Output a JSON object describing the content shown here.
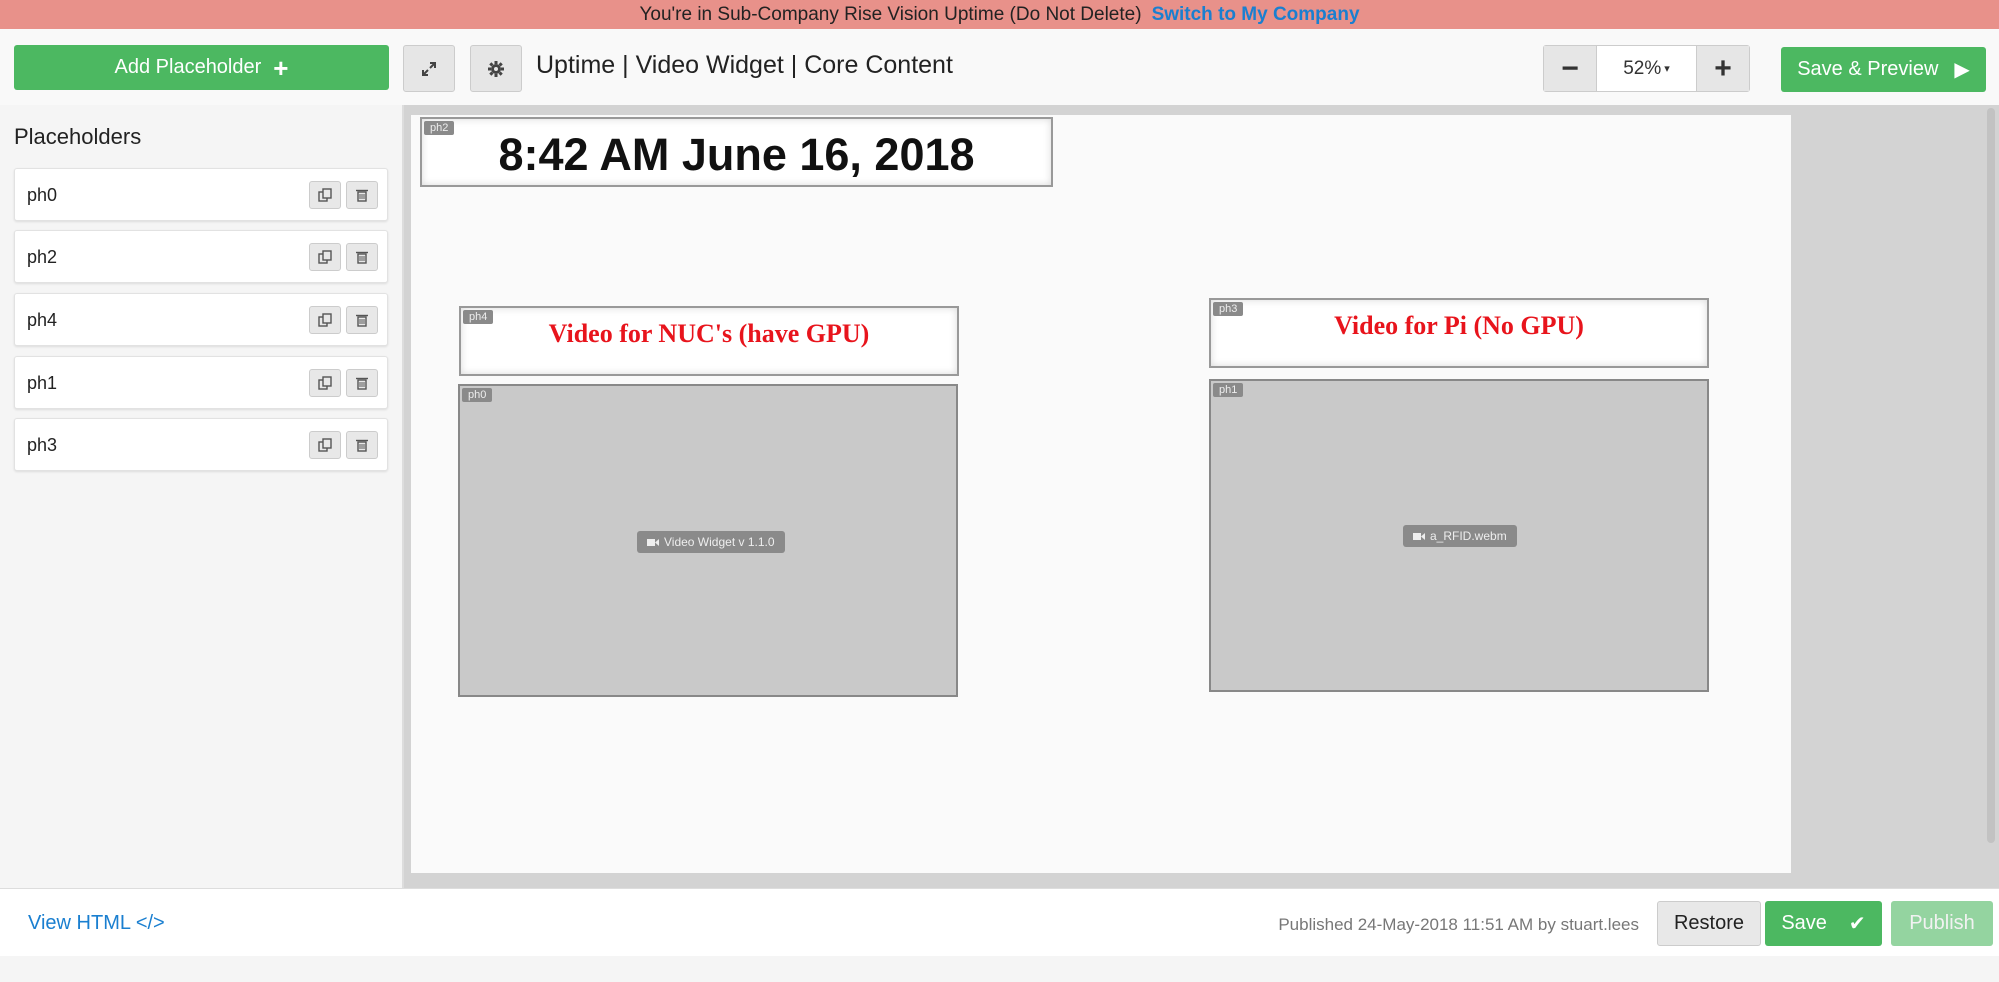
{
  "banner": {
    "message": "You're in Sub-Company Rise Vision Uptime (Do Not Delete)",
    "link": "Switch to My Company"
  },
  "toolbar": {
    "add_placeholder_label": "Add Placeholder",
    "add_placeholder_icon": "+",
    "expand_icon": "expand-icon",
    "settings_icon": "gear-icon",
    "presentation_title": "Uptime | Video Widget | Core Content",
    "zoom_out": "−",
    "zoom_value": "52%",
    "zoom_caret": "▾",
    "zoom_in": "+",
    "save_preview_label": "Save & Preview",
    "save_preview_icon": "▶"
  },
  "sidebar": {
    "title": "Placeholders",
    "items": [
      {
        "label": "ph0"
      },
      {
        "label": "ph2"
      },
      {
        "label": "ph4"
      },
      {
        "label": "ph1"
      },
      {
        "label": "ph3"
      }
    ]
  },
  "canvas": {
    "ph2": {
      "tag": "ph2",
      "content": "8:42 AM June 16, 2018"
    },
    "ph4": {
      "tag": "ph4",
      "content": "Video for NUC's (have GPU)"
    },
    "ph3": {
      "tag": "ph3",
      "content": "Video for Pi (No GPU)"
    },
    "ph0": {
      "tag": "ph0",
      "widget": "Video Widget v 1.1.0"
    },
    "ph1": {
      "tag": "ph1",
      "widget": "a_RFID.webm"
    }
  },
  "footer": {
    "view_html_label": "View HTML",
    "view_html_icon": "</>",
    "published_info": "Published 24-May-2018 11:51 AM by stuart.lees",
    "restore_label": "Restore",
    "save_label": "Save",
    "save_icon": "✔",
    "publish_label": "Publish"
  },
  "colors": {
    "banner_bg": "#e8918a",
    "accent_green": "#4cb861",
    "link_blue": "#1a7fd0",
    "title_red": "#e8141c"
  }
}
